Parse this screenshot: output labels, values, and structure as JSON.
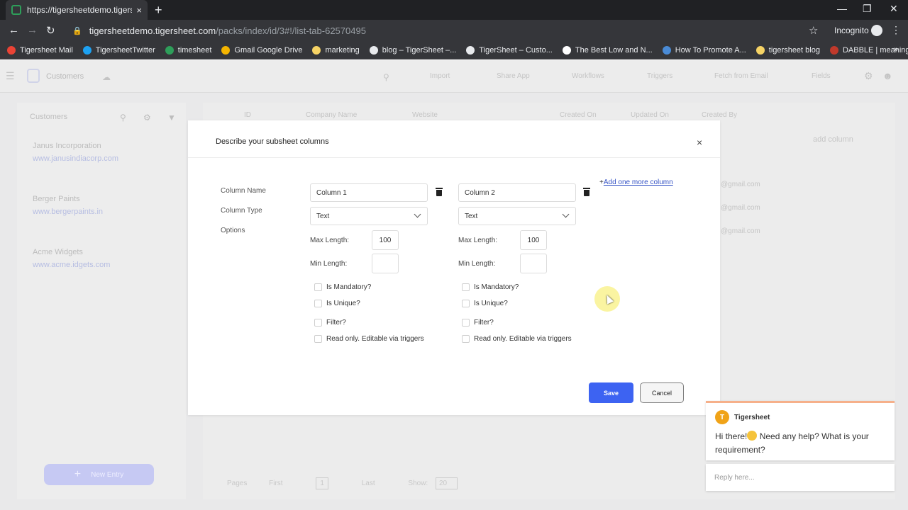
{
  "browser": {
    "tab_title": "https://tigersheetdemo.tigershee",
    "tab_close": "×",
    "new_tab": "+",
    "url_host": "tigersheetdemo.tigersheet.com",
    "url_path": "/packs/index/id/3#!/list-tab-62570495",
    "profile_label": "Incognito",
    "bookmarks": [
      {
        "label": "Tigersheet Mail",
        "icon": "google-icon",
        "color": "#ea4335"
      },
      {
        "label": "TigersheetTwitter",
        "icon": "twitter-icon",
        "color": "#1da1f2"
      },
      {
        "label": "timesheet",
        "icon": "tigersheet-icon",
        "color": "#2e9e5a"
      },
      {
        "label": "Gmail Google Drive",
        "icon": "drive-icon",
        "color": "#f4b400"
      },
      {
        "label": "marketing",
        "icon": "folder-icon",
        "color": "#f6d365"
      },
      {
        "label": "blog – TigerSheet –...",
        "icon": "globe-icon",
        "color": "#e8eaed"
      },
      {
        "label": "TigerSheet – Custo...",
        "icon": "globe-icon",
        "color": "#e8eaed"
      },
      {
        "label": "The Best Low and N...",
        "icon": "medium-icon",
        "color": "#ffffff"
      },
      {
        "label": "How To Promote A...",
        "icon": "biz-icon",
        "color": "#4a8bd6"
      },
      {
        "label": "tigersheet blog",
        "icon": "folder-icon",
        "color": "#f6d365"
      },
      {
        "label": "DABBLE | meaning i...",
        "icon": "dabble-icon",
        "color": "#c0392b"
      }
    ],
    "bookmarks_more": "»"
  },
  "app": {
    "title": "Customers",
    "header_items": [
      "Import",
      "Share App",
      "Workflows",
      "Triggers",
      "Fetch from Email",
      "Fields"
    ],
    "sidebar_title": "Customers",
    "customers": [
      {
        "name": "Janus Incorporation",
        "url": "www.janusindiacorp.com"
      },
      {
        "name": "Berger Paints",
        "url": "www.bergerpaints.in"
      },
      {
        "name": "Acme Widgets",
        "url": "www.acme.idgets.com"
      }
    ],
    "new_entry": "New Entry",
    "columns": [
      "ID",
      "Company Name",
      "Website",
      "Created On",
      "Updated On",
      "Created By"
    ],
    "emails": [
      "@gmail.com",
      "@gmail.com",
      "@gmail.com"
    ],
    "add_column": "add column",
    "pager": {
      "pages_label": "Pages",
      "first": "First",
      "page": "1",
      "last": "Last",
      "show_label": "Show:",
      "show_value": "20"
    }
  },
  "modal": {
    "title": "Describe your subsheet columns",
    "close": "×",
    "labels": {
      "column_name": "Column Name",
      "column_type": "Column Type",
      "options": "Options"
    },
    "add_more_prefix": "+",
    "add_more_link": "Add one more column",
    "columns": [
      {
        "name": "Column 1",
        "type": "Text",
        "max_length_label": "Max Length:",
        "max_length": "100",
        "min_length_label": "Min Length:",
        "min_length": "",
        "checks": [
          {
            "label": "Is Mandatory?",
            "checked": false
          },
          {
            "label": "Is Unique?",
            "checked": false
          },
          {
            "label": "Filter?",
            "checked": false
          },
          {
            "label": "Read only. Editable via triggers",
            "checked": false
          }
        ]
      },
      {
        "name": "Column 2",
        "type": "Text",
        "max_length_label": "Max Length:",
        "max_length": "100",
        "min_length_label": "Min Length:",
        "min_length": "",
        "checks": [
          {
            "label": "Is Mandatory?",
            "checked": false
          },
          {
            "label": "Is Unique?",
            "checked": false
          },
          {
            "label": "Filter?",
            "checked": false
          },
          {
            "label": "Read only. Editable via triggers",
            "checked": false
          }
        ]
      }
    ],
    "save": "Save",
    "cancel": "Cancel"
  },
  "chat": {
    "avatar": "T",
    "name": "Tigersheet",
    "message_a": "Hi there!",
    "message_b": " Need any help? What is your requirement?",
    "reply_placeholder": "Reply here..."
  },
  "colors": {
    "primary": "#3d63f2",
    "link": "#3553c5",
    "chat_avatar": "#f0a318"
  }
}
